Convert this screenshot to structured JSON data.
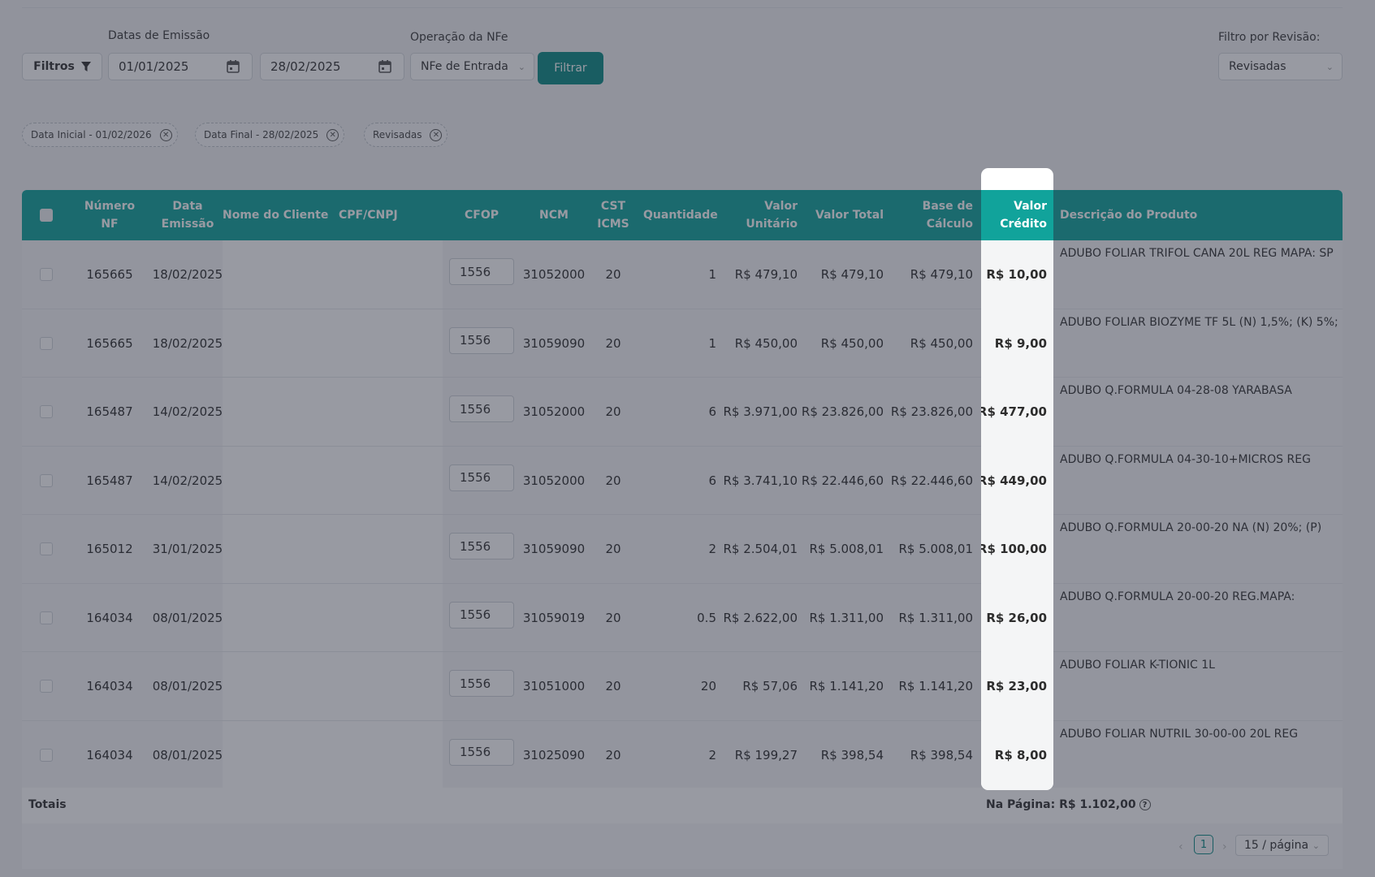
{
  "filters": {
    "dates_label": "Datas de Emissão",
    "operation_label": "Operação da NFe",
    "revision_label": "Filtro por Revisão:",
    "filtros_button": "Filtros",
    "date_start": "01/01/2025",
    "date_end": "28/02/2025",
    "operation_value": "NFe de Entrada",
    "filter_button": "Filtrar",
    "revision_value": "Revisadas"
  },
  "chips": [
    {
      "label": "Data Inicial - 01/02/2026"
    },
    {
      "label": "Data Final - 28/02/2025"
    },
    {
      "label": "Revisadas"
    }
  ],
  "table": {
    "headers": {
      "numero_nf": [
        "Número",
        "NF"
      ],
      "data_emissao": [
        "Data",
        "Emissão"
      ],
      "nome_cliente": "Nome do Cliente",
      "cpf_cnpj": "CPF/CNPJ",
      "cfop": "CFOP",
      "ncm": "NCM",
      "cst_icms": [
        "CST",
        "ICMS"
      ],
      "quantidade": "Quantidade",
      "valor_unitario": [
        "Valor",
        "Unitário"
      ],
      "valor_total": "Valor Total",
      "base_calculo": [
        "Base de",
        "Cálculo"
      ],
      "valor_credito": [
        "Valor",
        "Crédito"
      ],
      "descricao": "Descrição do Produto"
    },
    "rows": [
      {
        "nf": "165665",
        "data": "18/02/2025",
        "cfop": "1556",
        "ncm": "31052000",
        "cst": "20",
        "qtd": "1",
        "unit": "R$ 479,10",
        "total": "R$ 479,10",
        "base": "R$ 479,10",
        "credito": "R$ 10,00",
        "desc": "ADUBO FOLIAR TRIFOL CANA 20L REG MAPA: SP"
      },
      {
        "nf": "165665",
        "data": "18/02/2025",
        "cfop": "1556",
        "ncm": "31059090",
        "cst": "20",
        "qtd": "1",
        "unit": "R$ 450,00",
        "total": "R$ 450,00",
        "base": "R$ 450,00",
        "credito": "R$ 9,00",
        "desc": "ADUBO FOLIAR BIOZYME TF 5L (N) 1,5%; (K) 5%;"
      },
      {
        "nf": "165487",
        "data": "14/02/2025",
        "cfop": "1556",
        "ncm": "31052000",
        "cst": "20",
        "qtd": "6",
        "unit": "R$ 3.971,00",
        "total": "R$ 23.826,00",
        "base": "R$ 23.826,00",
        "credito": "R$ 477,00",
        "desc": "ADUBO Q.FORMULA 04-28-08 YARABASA"
      },
      {
        "nf": "165487",
        "data": "14/02/2025",
        "cfop": "1556",
        "ncm": "31052000",
        "cst": "20",
        "qtd": "6",
        "unit": "R$ 3.741,10",
        "total": "R$ 22.446,60",
        "base": "R$ 22.446,60",
        "credito": "R$ 449,00",
        "desc": "ADUBO Q.FORMULA 04-30-10+MICROS REG"
      },
      {
        "nf": "165012",
        "data": "31/01/2025",
        "cfop": "1556",
        "ncm": "31059090",
        "cst": "20",
        "qtd": "2",
        "unit": "R$ 2.504,01",
        "total": "R$ 5.008,01",
        "base": "R$ 5.008,01",
        "credito": "R$ 100,00",
        "desc": "ADUBO Q.FORMULA 20-00-20 NA (N) 20%; (P)"
      },
      {
        "nf": "164034",
        "data": "08/01/2025",
        "cfop": "1556",
        "ncm": "31059019",
        "cst": "20",
        "qtd": "0.5",
        "unit": "R$ 2.622,00",
        "total": "R$ 1.311,00",
        "base": "R$ 1.311,00",
        "credito": "R$ 26,00",
        "desc": "ADUBO Q.FORMULA 20-00-20 REG.MAPA:"
      },
      {
        "nf": "164034",
        "data": "08/01/2025",
        "cfop": "1556",
        "ncm": "31051000",
        "cst": "20",
        "qtd": "20",
        "unit": "R$ 57,06",
        "total": "R$ 1.141,20",
        "base": "R$ 1.141,20",
        "credito": "R$ 23,00",
        "desc": "ADUBO FOLIAR K-TIONIC 1L"
      },
      {
        "nf": "164034",
        "data": "08/01/2025",
        "cfop": "1556",
        "ncm": "31025090",
        "cst": "20",
        "qtd": "2",
        "unit": "R$ 199,27",
        "total": "R$ 398,54",
        "base": "R$ 398,54",
        "credito": "R$ 8,00",
        "desc": "ADUBO FOLIAR NUTRIL 30-00-00 20L REG"
      }
    ]
  },
  "totals": {
    "label": "Totais",
    "page_total": "Na Página: R$ 1.102,00"
  },
  "pagination": {
    "current_page": "1",
    "page_size": "15 / página"
  },
  "theme": {
    "accent": "#11a39b",
    "button": "#0d8a85"
  },
  "icons": [
    "filter-icon",
    "calendar-icon",
    "chevron-down-icon",
    "close-circle-icon",
    "help-icon",
    "chevron-left-icon",
    "chevron-right-icon"
  ]
}
